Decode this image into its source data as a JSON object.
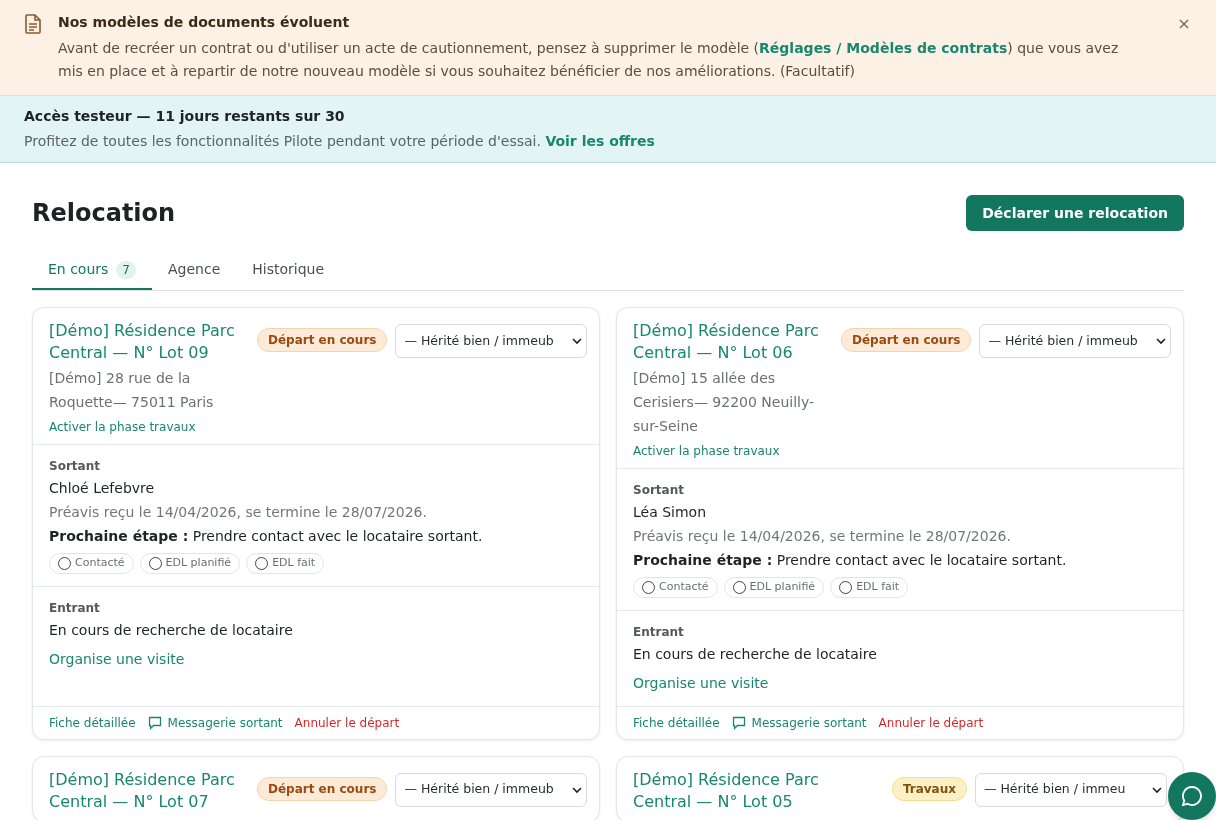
{
  "notice": {
    "title": "Nos modèles de documents évoluent",
    "text_before": "Avant de recréer un contrat ou d'utiliser un acte de cautionnement, pensez à supprimer le modèle (",
    "link": "Réglages / Modèles de contrats",
    "text_after": ") que vous avez mis en place et à repartir de notre nouveau modèle si vous souhaitez bénéficier de nos améliorations. (Facultatif)"
  },
  "trial": {
    "title": "Accès testeur — 11 jours restants sur 30",
    "text": "Profitez de toutes les fonctionnalités Pilote pendant votre période d'essai.",
    "link": "Voir les offres"
  },
  "page": {
    "title": "Relocation",
    "action": "Déclarer une relocation"
  },
  "tabs": [
    {
      "label": "En cours",
      "count": "7",
      "selected": true
    },
    {
      "label": "Agence",
      "selected": false
    },
    {
      "label": "Historique",
      "selected": false
    }
  ],
  "cards": [
    {
      "title": "[Démo] Résidence Parc Central — N° Lot 09",
      "badge": {
        "kind": "depart",
        "label": "Départ en cours"
      },
      "select": "— Hérité bien / immeub",
      "address": "[Démo] 28 rue de la Roquette— 75011 Paris",
      "works_link": "Activer la phase travaux",
      "outgoing": {
        "label": "Sortant",
        "name": "Chloé Lefebvre",
        "notice": "Préavis reçu le 14/04/2026, se termine le 28/07/2026.",
        "next_label": "Prochaine étape :",
        "next_text": "Prendre contact avec le locataire sortant.",
        "steps": [
          {
            "label": "Contacté",
            "checked": false
          },
          {
            "label": "EDL planifié",
            "checked": false
          },
          {
            "label": "EDL fait",
            "checked": false
          }
        ]
      },
      "incoming": {
        "label": "Entrant",
        "status": "En cours de recherche de locataire",
        "link": "Organise une visite"
      },
      "footer": {
        "details": "Fiche détaillée",
        "messages": "Messagerie sortant",
        "cancel": "Annuler le départ"
      }
    },
    {
      "title": "[Démo] Résidence Parc Central — N° Lot 06",
      "badge": {
        "kind": "depart",
        "label": "Départ en cours"
      },
      "select": "— Hérité bien / immeub",
      "address": "[Démo] 15 allée des Cerisiers— 92200 Neuilly-sur-Seine",
      "works_link": "Activer la phase travaux",
      "outgoing": {
        "label": "Sortant",
        "name": "Léa Simon",
        "notice": "Préavis reçu le 14/04/2026, se termine le 28/07/2026.",
        "next_label": "Prochaine étape :",
        "next_text": "Prendre contact avec le locataire sortant.",
        "steps": [
          {
            "label": "Contacté",
            "checked": false
          },
          {
            "label": "EDL planifié",
            "checked": false
          },
          {
            "label": "EDL fait",
            "checked": false
          }
        ]
      },
      "incoming": {
        "label": "Entrant",
        "status": "En cours de recherche de locataire",
        "link": "Organise une visite"
      },
      "footer": {
        "details": "Fiche détaillée",
        "messages": "Messagerie sortant",
        "cancel": "Annuler le départ"
      }
    },
    {
      "title": "[Démo] Résidence Parc Central — N° Lot 07",
      "badge": {
        "kind": "depart",
        "label": "Départ en cours"
      },
      "select": "— Hérité bien / immeub"
    },
    {
      "title": "[Démo] Résidence Parc Central — N° Lot 05",
      "badge": {
        "kind": "travaux",
        "label": "Travaux"
      },
      "select": "— Hérité bien / immeu"
    }
  ]
}
